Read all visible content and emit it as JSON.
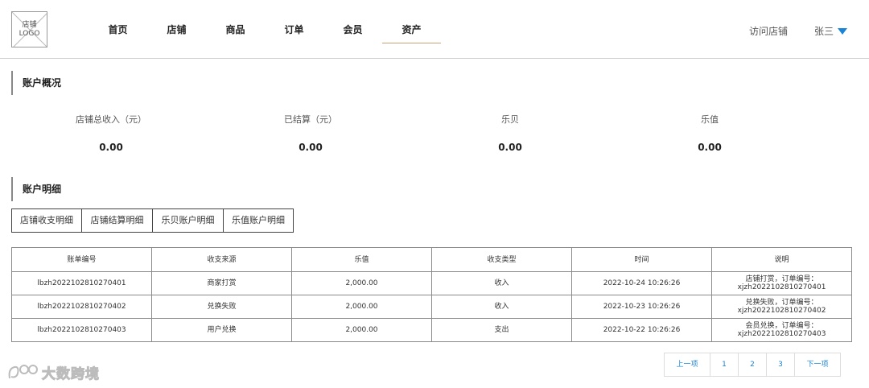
{
  "header": {
    "logo_text": "店铺\nLOGO",
    "nav": [
      "首页",
      "店铺",
      "商品",
      "订单",
      "会员",
      "资产"
    ],
    "active_nav": "资产",
    "visit_store": "访问店铺",
    "user_name": "张三",
    "accent_color": "#1a84d6"
  },
  "overview": {
    "title": "账户概况",
    "stats": [
      {
        "label": "店铺总收入（元）",
        "value": "0.00"
      },
      {
        "label": "已结算（元）",
        "value": "0.00"
      },
      {
        "label": "乐贝",
        "value": "0.00"
      },
      {
        "label": "乐值",
        "value": "0.00"
      }
    ]
  },
  "details": {
    "title": "账户明细",
    "tabs": [
      "店铺收支明细",
      "店铺结算明细",
      "乐贝账户明细",
      "乐值账户明细"
    ],
    "table": {
      "headers": [
        "账单编号",
        "收支来源",
        "乐值",
        "收支类型",
        "时间",
        "说明"
      ],
      "rows": [
        [
          "lbzh2022102810270401",
          "商家打赏",
          "2,000.00",
          "收入",
          "2022-10-24 10:26:26",
          "店铺打赏，订单编号：\nxjzh2022102810270401"
        ],
        [
          "lbzh2022102810270402",
          "兑换失败",
          "2,000.00",
          "收入",
          "2022-10-23 10:26:26",
          "兑换失败，订单编号：\nxjzh2022102810270402"
        ],
        [
          "lbzh2022102810270403",
          "用户兑换",
          "2,000.00",
          "支出",
          "2022-10-22 10:26:26",
          "会员兑换，订单编号：\nxjzh2022102810270403"
        ]
      ]
    }
  },
  "pagination": {
    "prev": "上一项",
    "pages": [
      "1",
      "2",
      "3"
    ],
    "next": "下一项"
  },
  "watermark": {
    "text": "大数跨境"
  }
}
